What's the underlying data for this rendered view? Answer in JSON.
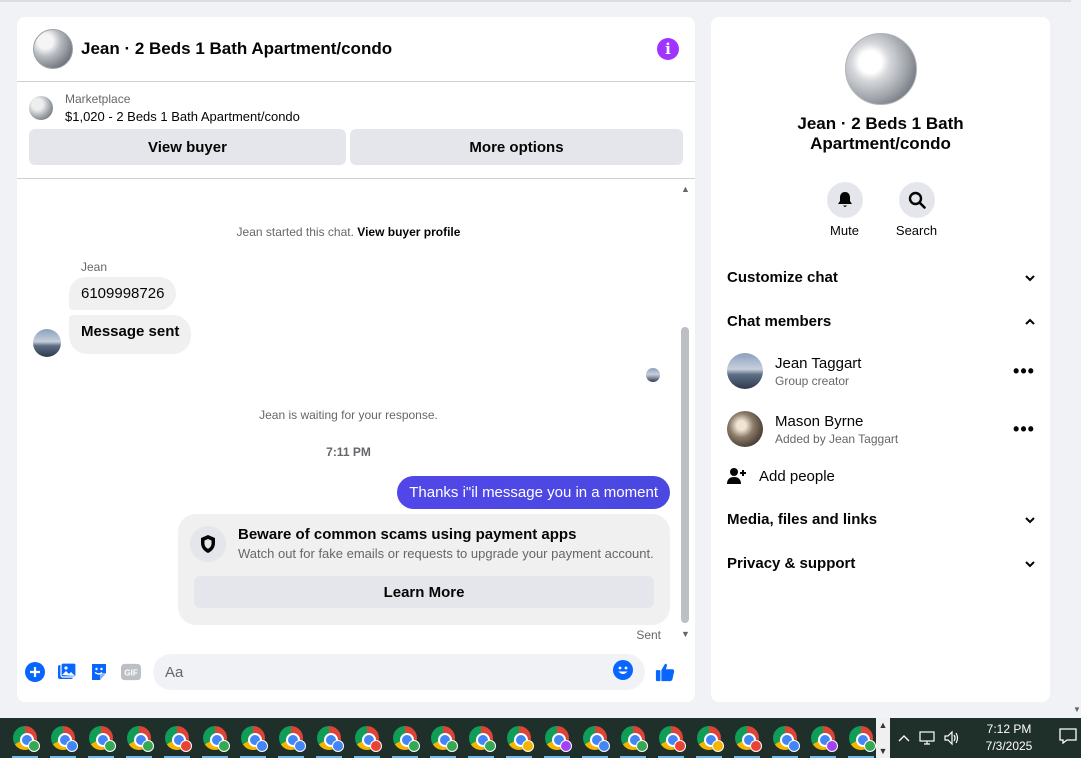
{
  "chat": {
    "title": "Jean · 2 Beds 1 Bath Apartment/condo",
    "listing": {
      "label": "Marketplace",
      "price_title": "$1,020 - 2 Beds 1 Bath Apartment/condo",
      "view_buyer": "View buyer",
      "more_options": "More options"
    },
    "messages": {
      "started_prefix": "Jean started this chat.",
      "view_buyer_profile": "View buyer profile",
      "sender_name": "Jean",
      "msg1": "6109998726",
      "msg2": "Message sent",
      "waiting": "Jean is waiting for your response.",
      "time": "7:11 PM",
      "outgoing": "Thanks i\"il message you in a moment",
      "sent": "Sent"
    },
    "scam_card": {
      "title": "Beware of common scams using payment apps",
      "desc": "Watch out for fake emails or requests to upgrade your payment account.",
      "button": "Learn More"
    },
    "composer": {
      "placeholder": "Aa"
    }
  },
  "info_panel": {
    "title": "Jean · 2 Beds 1 Bath Apartment/condo",
    "actions": [
      {
        "label": "Mute",
        "icon": "bell-icon"
      },
      {
        "label": "Search",
        "icon": "search-icon"
      }
    ],
    "sections": {
      "customize": "Customize chat",
      "members": "Chat members",
      "media": "Media, files and links",
      "privacy": "Privacy & support"
    },
    "members": [
      {
        "name": "Jean Taggart",
        "role": "Group creator"
      },
      {
        "name": "Mason Byrne",
        "role": "Added by Jean Taggart"
      }
    ],
    "add_people": "Add people"
  },
  "taskbar": {
    "time": "7:12 PM",
    "date": "7/3/2025",
    "badge_colors": [
      "#34a853",
      "#4285f4",
      "#34a853",
      "#34a853",
      "#ea4335",
      "#34a853",
      "#4285f4",
      "#4285f4",
      "#4285f4",
      "#ea4335",
      "#34a853",
      "#34a853",
      "#34a853",
      "#f4b400",
      "#a142f4",
      "#4285f4",
      "#34a853",
      "#ea4335",
      "#f4b400",
      "#ea4335",
      "#4285f4",
      "#a142f4",
      "#34a853"
    ]
  },
  "colors": {
    "accent": "#a033ff",
    "outgoing_bubble": "#4f46e5",
    "messenger_blue": "#0866ff"
  }
}
